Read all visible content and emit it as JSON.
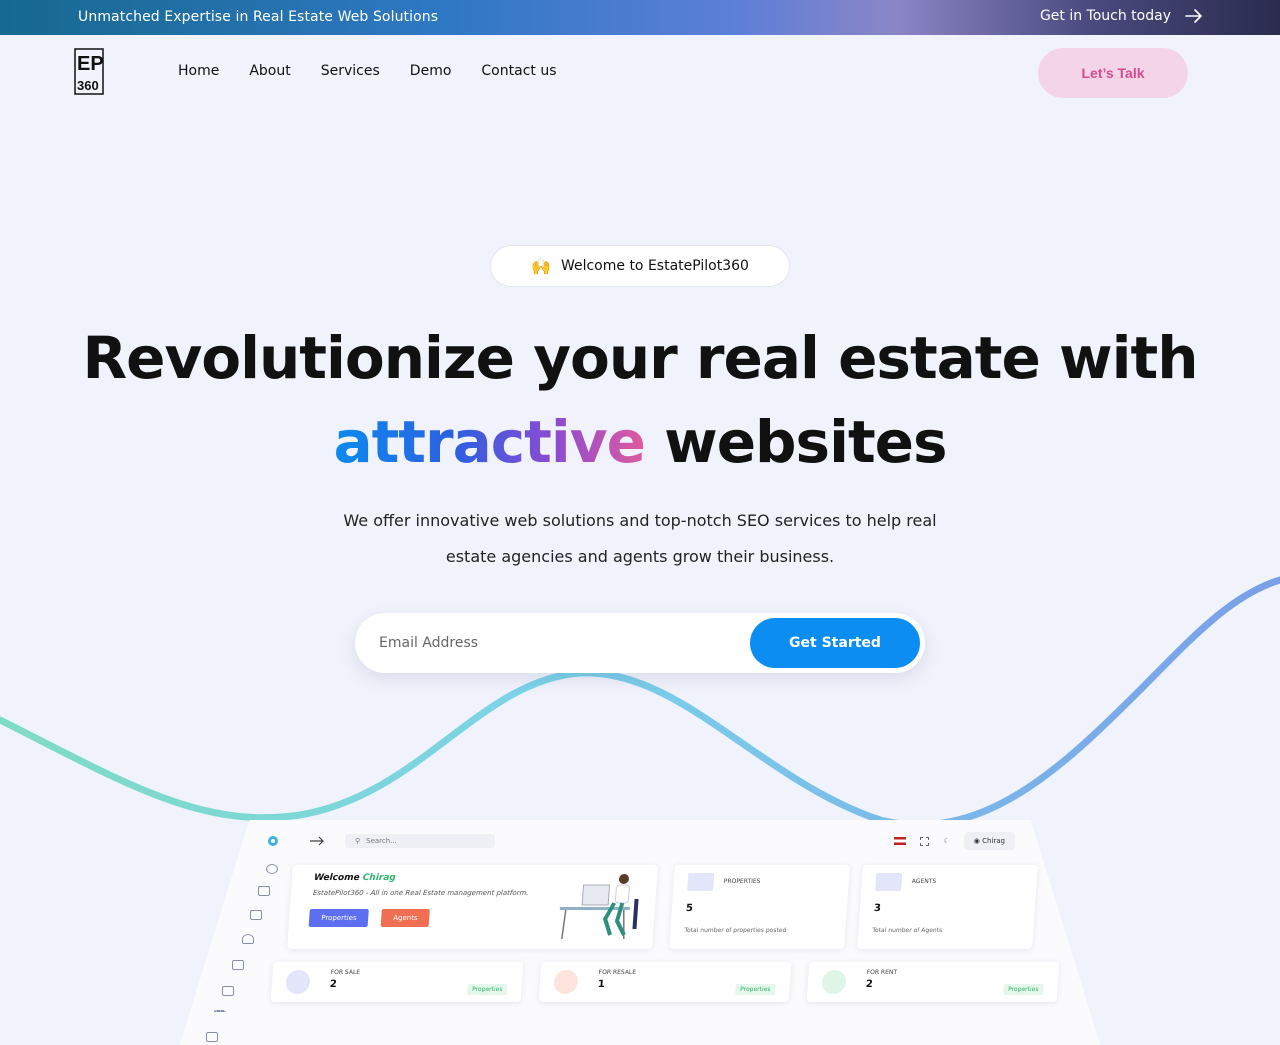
{
  "topbar": {
    "message": "Unmatched Expertise in Real Estate Web Solutions",
    "cta": "Get in Touch today"
  },
  "logo": {
    "line1": "EP",
    "line2": "360"
  },
  "nav": {
    "items": [
      "Home",
      "About",
      "Services",
      "Demo",
      "Contact us"
    ],
    "talk_button": "Let’s Talk"
  },
  "hero": {
    "pill_emoji": "🙌",
    "pill_text": "Welcome to EstatePilot360",
    "headline_line1": "Revolutionize your real estate with",
    "headline_gradient": "attractive",
    "headline_rest": "websites",
    "subtext": "We offer innovative web solutions and top-notch SEO services to help real estate agencies and agents grow their business.",
    "email_placeholder": "Email Address",
    "submit_label": "Get Started"
  },
  "dashboard": {
    "search_placeholder": "Search...",
    "user_name": "Chirag",
    "welcome_prefix": "Welcome",
    "welcome_name": "Chirag",
    "welcome_sub": "EstatePilot360 - All in one Real Estate management platform.",
    "btn_properties": "Properties",
    "btn_agents": "Agents",
    "stats": [
      {
        "label": "PROPERTIES",
        "value": "5",
        "desc": "Total number of properties posted"
      },
      {
        "label": "AGENTS",
        "value": "3",
        "desc": "Total number of Agents"
      }
    ],
    "sales": [
      {
        "label": "FOR SALE",
        "value": "2",
        "tag": "Properties"
      },
      {
        "label": "FOR RESALE",
        "value": "1",
        "tag": "Properties"
      },
      {
        "label": "FOR RENT",
        "value": "2",
        "tag": "Properties"
      }
    ]
  },
  "colors": {
    "primary": "#0c8df2",
    "talk_bg": "#f4d5e7",
    "talk_text": "#d64a8f",
    "page_bg": "#f1f3fc"
  }
}
